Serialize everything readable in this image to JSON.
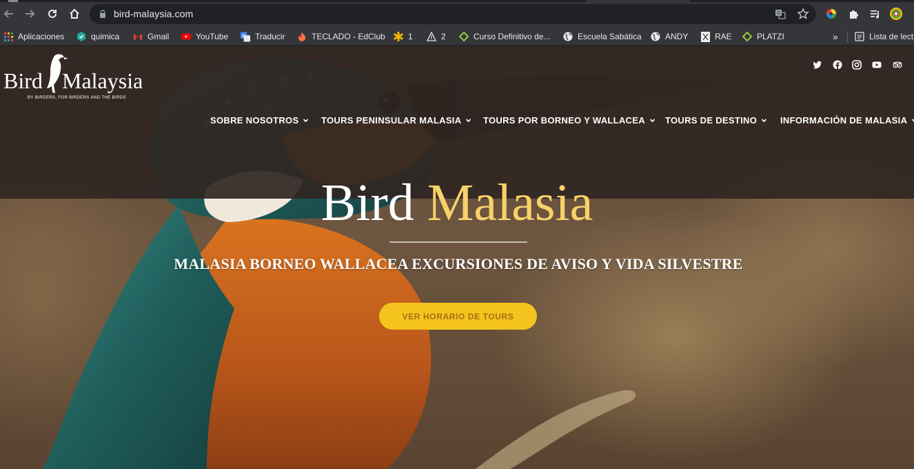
{
  "browser": {
    "url": "bird-malaysia.com",
    "bookmarks": [
      {
        "label": "Aplicaciones",
        "icon": "apps-grid-icon"
      },
      {
        "label": "quimica",
        "icon": "quimica-icon"
      },
      {
        "label": "Gmail",
        "icon": "gmail-icon"
      },
      {
        "label": "YouTube",
        "icon": "youtube-icon"
      },
      {
        "label": "Traducir",
        "icon": "translate-icon"
      },
      {
        "label": "TECLADO - EdClub",
        "icon": "edclub-icon"
      },
      {
        "label": "1",
        "icon": "asterisk-icon"
      },
      {
        "label": "2",
        "icon": "triangle-icon"
      },
      {
        "label": "Curso Definitivo de...",
        "icon": "diamond-icon"
      },
      {
        "label": "Escuela Sabática",
        "icon": "globe-icon"
      },
      {
        "label": "ANDY",
        "icon": "globe-icon"
      },
      {
        "label": "RAE",
        "icon": "rae-icon"
      },
      {
        "label": "PLATZI",
        "icon": "platzi-icon"
      }
    ],
    "more_bookmarks": "»",
    "reading_list": "Lista de lect"
  },
  "site": {
    "logo": {
      "word1": "Bird",
      "word2": "Malaysia",
      "tagline": "BY BIRDERS, FOR BIRDERS AND THE BIRDS"
    },
    "social_icons": [
      "twitter-icon",
      "facebook-icon",
      "instagram-icon",
      "youtube-icon",
      "tripadvisor-icon"
    ],
    "nav": [
      {
        "label": "SOBRE NOSOTROS"
      },
      {
        "label": "TOURS PENINSULAR MALASIA"
      },
      {
        "label": "TOURS POR BORNEO Y WALLACEA"
      },
      {
        "label": "TOURS DE DESTINO"
      },
      {
        "label": "INFORMACIÓN DE MALASIA"
      }
    ],
    "hero": {
      "title_white": "Bird",
      "title_gold": "Malasia",
      "subtitle": "MALASIA BORNEO WALLACEA EXCURSIONES DE AVISO Y VIDA SILVESTRE",
      "button": "VER HORARIO DE TOURS"
    },
    "colors": {
      "accent_gold": "#f7d26a",
      "button": "#f5c31d",
      "header": "#30261f"
    }
  }
}
